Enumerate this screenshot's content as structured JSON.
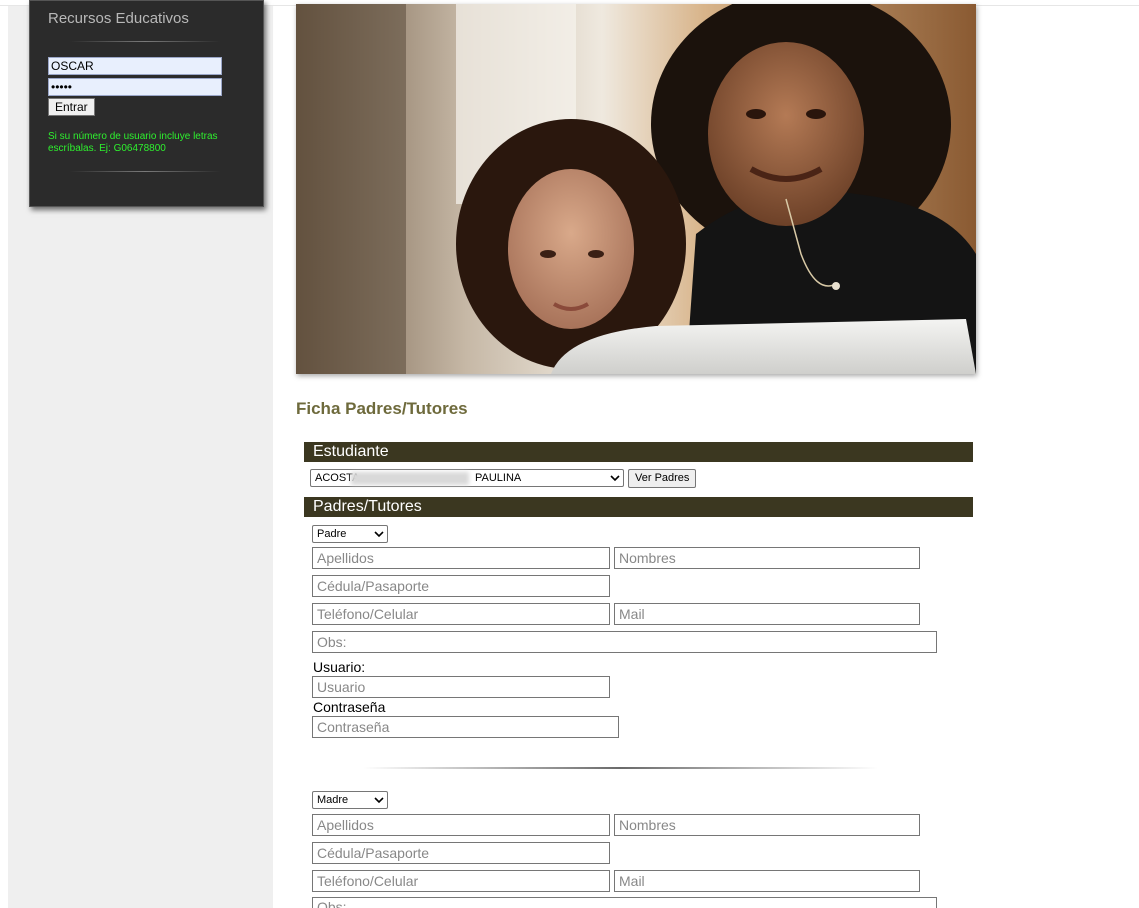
{
  "sidebar": {
    "title": "Recursos Educativos",
    "username_value": "OSCAR",
    "password_value": "•••••",
    "login_button": "Entrar",
    "note": "Si su número de usuario incluye letras escríbalas. Ej: G06478800"
  },
  "page_title": "Ficha Padres/Tutores",
  "estudiante": {
    "section_label": "Estudiante",
    "student_first": "ACOSTA",
    "student_last": "PAULINA",
    "ver_padres_button": "Ver Padres"
  },
  "padres": {
    "section_label": "Padres/Tutores",
    "father": {
      "relation": "Padre",
      "apellidos_placeholder": "Apellidos",
      "nombres_placeholder": "Nombres",
      "cedula_placeholder": "Cédula/Pasaporte",
      "telefono_placeholder": "Teléfono/Celular",
      "mail_placeholder": "Mail",
      "obs_placeholder": "Obs:",
      "usuario_label": "Usuario:",
      "usuario_placeholder": "Usuario",
      "contrasena_label": "Contraseña",
      "contrasena_placeholder": "Contraseña"
    },
    "mother": {
      "relation": "Madre",
      "apellidos_placeholder": "Apellidos",
      "nombres_placeholder": "Nombres",
      "cedula_placeholder": "Cédula/Pasaporte",
      "telefono_placeholder": "Teléfono/Celular",
      "mail_placeholder": "Mail",
      "obs_placeholder": "Obs:"
    }
  },
  "colors": {
    "section_bar": "#3b3720",
    "title_olive": "#6e6a3c",
    "note_green": "#2ef02e",
    "sidebar_bg": "#2b2b2b"
  }
}
